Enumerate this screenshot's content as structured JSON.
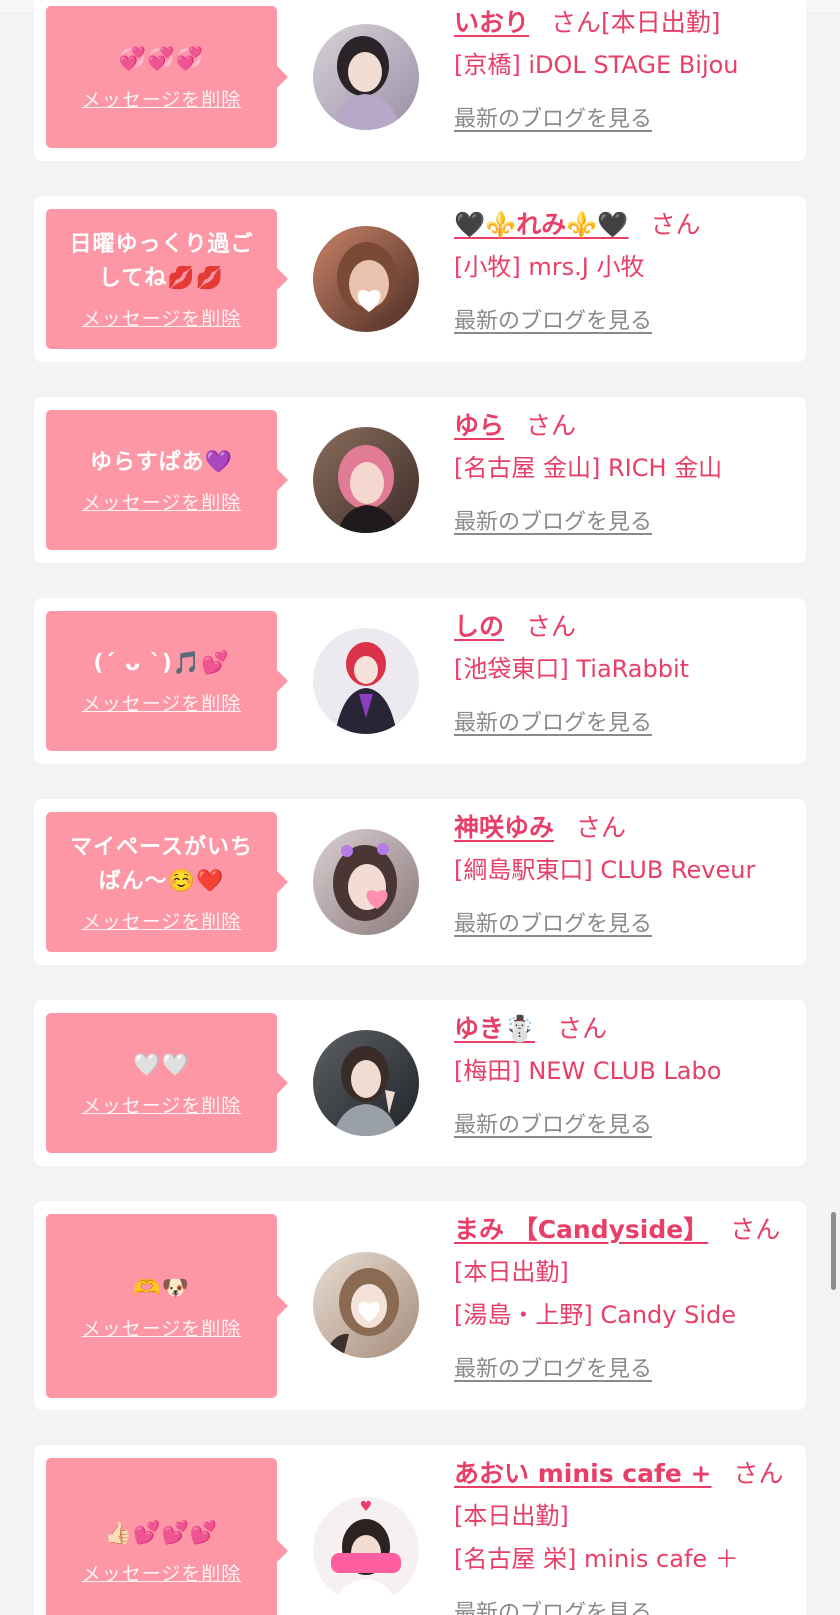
{
  "cards": [
    {
      "message": "💞💞💞",
      "delete_label": "メッセージを削除",
      "name": "いおり",
      "san": "さん",
      "shift": "[本日出勤]",
      "shop": "[京橋] iDOL STAGE Bijou",
      "blog_label": "最新のブログを見る",
      "avatar_icon": "girl-photo-icon"
    },
    {
      "message": "日曜ゆっくり過ごしてね💋💋",
      "delete_label": "メッセージを削除",
      "name": "🖤⚜️れみ⚜️🖤",
      "san": "さん",
      "shop": "[小牧] mrs.J 小牧",
      "blog_label": "最新のブログを見る",
      "avatar_icon": "girl-photo-icon"
    },
    {
      "message": "ゆらすぱあ💜",
      "delete_label": "メッセージを削除",
      "name": "ゆら",
      "san": "さん",
      "shop": "[名古屋 金山] RICH 金山",
      "blog_label": "最新のブログを見る",
      "avatar_icon": "girl-photo-icon"
    },
    {
      "message": "(ˊ ᴗ ˋ)🎵💕",
      "delete_label": "メッセージを削除",
      "name": "しの",
      "san": "さん",
      "shop": "[池袋東口] TiaRabbit",
      "blog_label": "最新のブログを見る",
      "avatar_icon": "girl-photo-icon"
    },
    {
      "message": "マイペースがいちばん〜☺️❤️",
      "delete_label": "メッセージを削除",
      "name": "神咲ゆみ",
      "san": "さん",
      "shop": "[綱島駅東口] CLUB Reveur",
      "blog_label": "最新のブログを見る",
      "avatar_icon": "girl-photo-icon"
    },
    {
      "message": "🤍🤍",
      "delete_label": "メッセージを削除",
      "name": "ゆき☃️",
      "san": "さん",
      "shop": "[梅田] NEW CLUB Labo",
      "blog_label": "最新のブログを見る",
      "avatar_icon": "girl-photo-icon"
    },
    {
      "message": "🫶🐶",
      "delete_label": "メッセージを削除",
      "name": "まみ 【Candyside】",
      "san": "さん",
      "shift": "[本日出勤]",
      "shop": "[湯島・上野] Candy Side",
      "blog_label": "最新のブログを見る",
      "avatar_icon": "girl-photo-icon"
    },
    {
      "message": "👍🏻💕💕💕",
      "delete_label": "メッセージを削除",
      "name": "あおい minis cafe +",
      "san": "さん",
      "shift": "[本日出勤]",
      "shop": "[名古屋 栄] minis cafe ＋",
      "blog_label": "最新のブログを見る",
      "avatar_icon": "girl-photo-icon"
    }
  ],
  "colors": {
    "accent": "#e83e68",
    "message_bg": "#fd96a5",
    "card_bg": "#ffffff",
    "page_bg": "#f3f3f3",
    "link_gray": "#8a8a8a"
  }
}
